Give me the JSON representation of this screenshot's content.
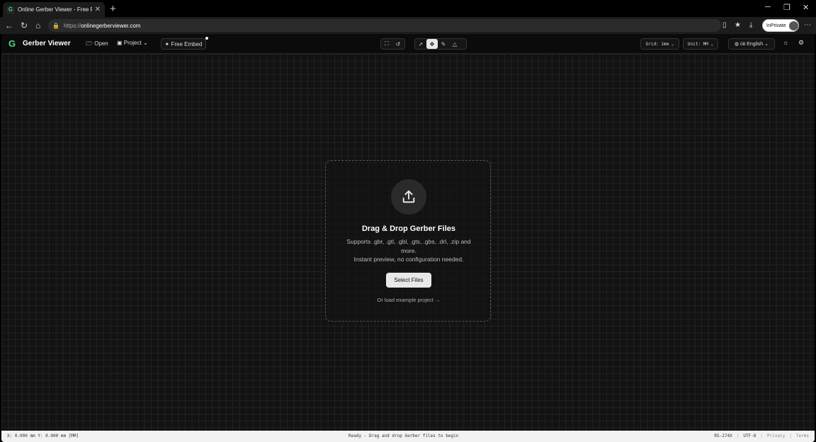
{
  "browser": {
    "tab_title": "Online Gerber Viewer - Free PCB G",
    "url_prefix": "https://",
    "url_domain": "onlinegerberviewer.com",
    "inprivate_label": "InPrivate"
  },
  "toolbar": {
    "brand": "Gerber Viewer",
    "open_label": "Open",
    "project_label": "Project",
    "free_embed_label": "Free Embed",
    "grid_label": "Grid: 1mm",
    "unit_label": "Unit: MM",
    "language_label": "English",
    "language_code": "GB"
  },
  "dropzone": {
    "title": "Drag & Drop Gerber Files",
    "desc_line1": "Supports .gbr, .gtl, .gbl, .gts, .gbs, .drl, .zip and more.",
    "desc_line2": "Instant preview, no configuration needed.",
    "button": "Select Files",
    "example_link": "Or load example project →"
  },
  "status": {
    "coords": "X: 0.000 mm Y: 0.000 mm [MM]",
    "message": "Ready - Drag and drop Gerber files to begin",
    "standard": "RS-274X",
    "encoding": "UTF-8",
    "privacy": "Privacy",
    "terms": "Terms"
  },
  "colors": {
    "accent": "#4ade80",
    "canvas": "#121212",
    "grid": "#222222"
  }
}
